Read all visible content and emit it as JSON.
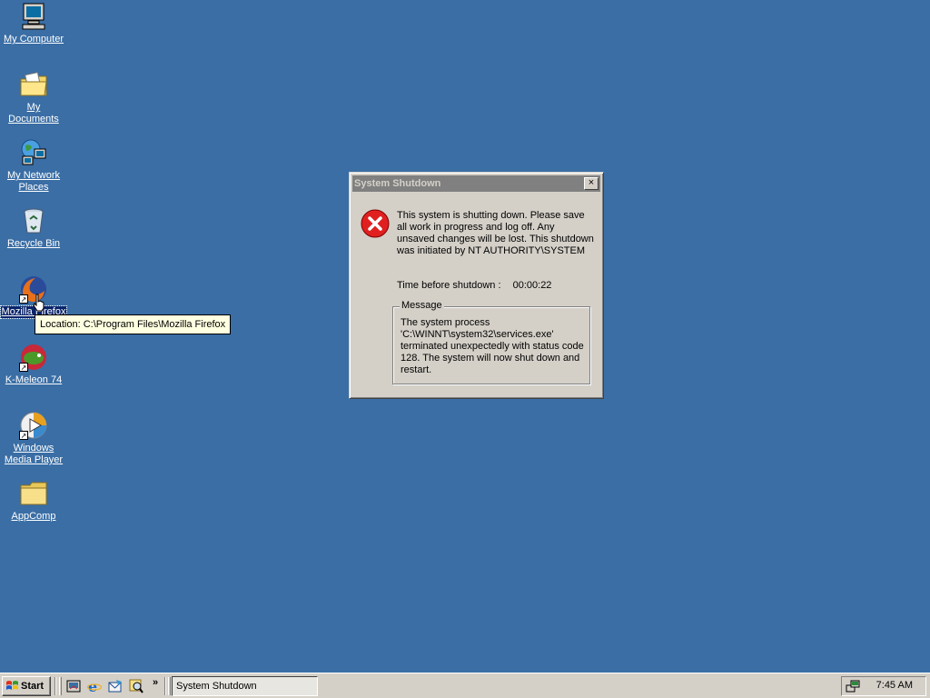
{
  "desktop": {
    "icons": [
      {
        "label": "My Computer"
      },
      {
        "label": "My Documents"
      },
      {
        "label": "My Network Places"
      },
      {
        "label": "Recycle Bin"
      },
      {
        "label": "Mozilla Firefox"
      },
      {
        "label": "K-Meleon 74"
      },
      {
        "label": "Windows Media Player"
      },
      {
        "label": "AppComp"
      }
    ],
    "background_color": "#3a6ea5",
    "tooltip": "Location: C:\\Program Files\\Mozilla Firefox"
  },
  "dialog": {
    "title": "System Shutdown",
    "close_label": "×",
    "icon": "error-x-icon",
    "message": "This system is shutting down. Please save all work in progress and log off. Any unsaved changes will be lost. This shutdown was initiated by NT AUTHORITY\\SYSTEM",
    "time_label": "Time before shutdown :",
    "time_value": "00:00:22",
    "group_title": "Message",
    "group_message": "The system process 'C:\\WINNT\\system32\\services.exe' terminated unexpectedly with status code 128.  The system will now shut down and restart."
  },
  "taskbar": {
    "start_label": "Start",
    "quick_launch": [
      "show-desktop-icon",
      "internet-explorer-icon",
      "outlook-express-icon",
      "search-icon"
    ],
    "more_label": "»",
    "tasks": [
      {
        "label": "System Shutdown"
      }
    ],
    "clock": "7:45 AM"
  }
}
